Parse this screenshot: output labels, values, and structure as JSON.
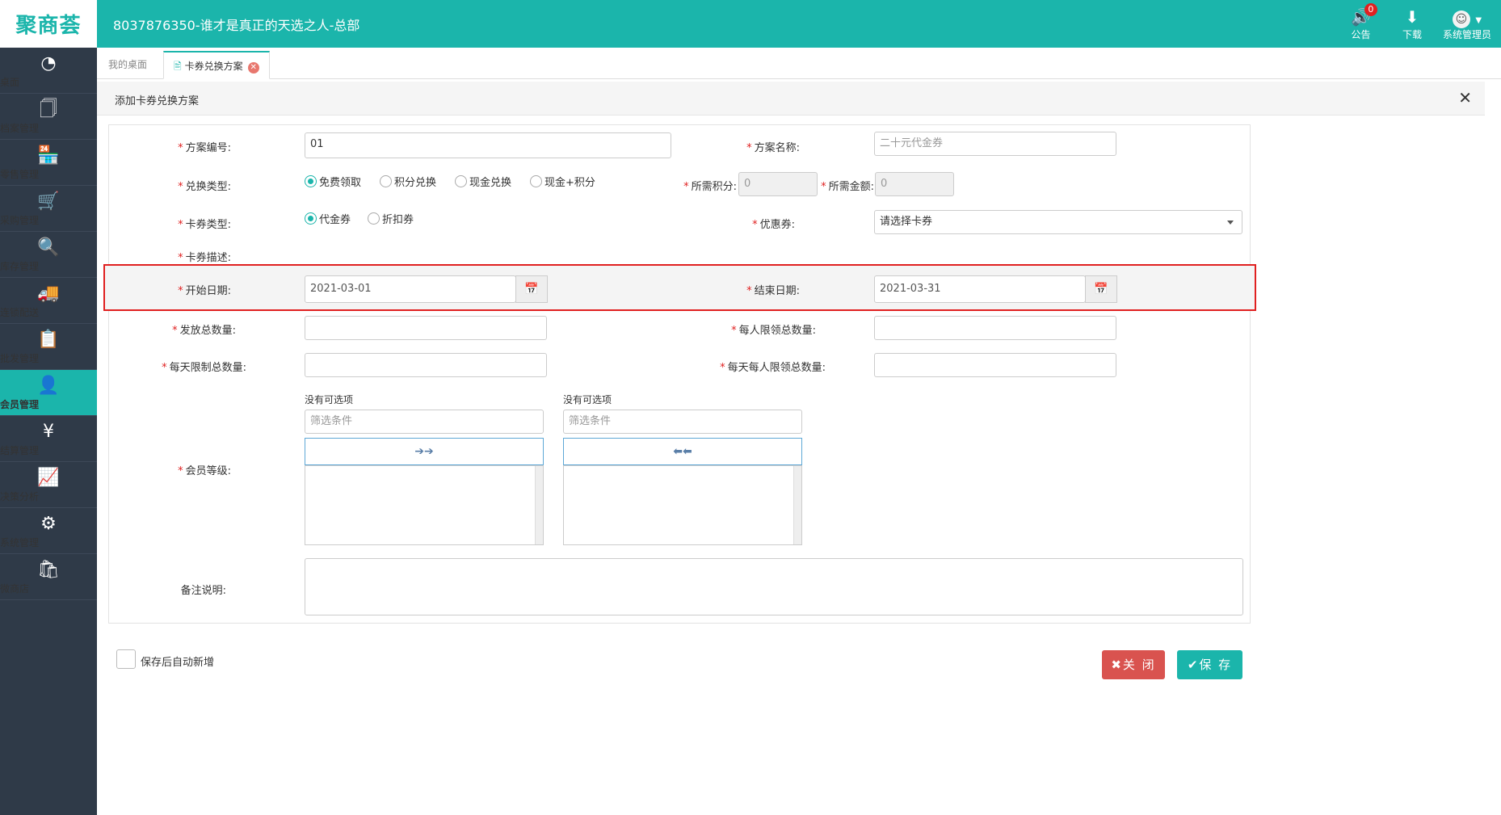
{
  "app": {
    "logo": "聚商荟",
    "title": "8037876350-谁才是真正的天选之人-总部"
  },
  "top_actions": {
    "notice": {
      "label": "公告",
      "badge": "0",
      "icon": "megaphone-icon"
    },
    "download": {
      "label": "下载",
      "icon": "download-icon"
    },
    "user": {
      "label": "系统管理员",
      "icon": "user-avatar-icon"
    }
  },
  "sidebar": {
    "items": [
      {
        "label": "桌面",
        "icon": "dashboard-icon"
      },
      {
        "label": "档案管理",
        "icon": "archive-icon"
      },
      {
        "label": "零售管理",
        "icon": "store-icon"
      },
      {
        "label": "采购管理",
        "icon": "cart-icon"
      },
      {
        "label": "库存管理",
        "icon": "inventory-icon"
      },
      {
        "label": "连锁配送",
        "icon": "truck-icon"
      },
      {
        "label": "批发管理",
        "icon": "wholesale-icon"
      },
      {
        "label": "会员管理",
        "icon": "member-icon",
        "active": true
      },
      {
        "label": "结算管理",
        "icon": "yen-icon"
      },
      {
        "label": "决策分析",
        "icon": "chart-icon"
      },
      {
        "label": "系统管理",
        "icon": "gear-icon"
      },
      {
        "label": "微商店",
        "icon": "bag-icon"
      }
    ]
  },
  "tabs": [
    {
      "label": "我的桌面"
    },
    {
      "label": "卡券兑换方案",
      "active": true
    }
  ],
  "panel": {
    "title": "添加卡券兑换方案"
  },
  "form": {
    "plan_no": {
      "label": "方案编号:",
      "value": "01"
    },
    "plan_name": {
      "label": "方案名称:",
      "placeholder": "二十元代金券"
    },
    "exchange_type": {
      "label": "兑换类型:",
      "options": [
        "免费领取",
        "积分兑换",
        "现金兑换",
        "现金+积分"
      ],
      "selected": "免费领取"
    },
    "points_needed": {
      "label": "所需积分:",
      "value": "0"
    },
    "amount_needed": {
      "label": "所需金额:",
      "value": "0"
    },
    "card_type": {
      "label": "卡券类型:",
      "options": [
        "代金券",
        "折扣券"
      ],
      "selected": "代金券"
    },
    "coupon": {
      "label": "优惠券:",
      "value": "请选择卡券"
    },
    "card_desc": {
      "label": "卡券描述:"
    },
    "start_date": {
      "label": "开始日期:",
      "value": "2021-03-01"
    },
    "end_date": {
      "label": "结束日期:",
      "value": "2021-03-31"
    },
    "total_issue": {
      "label": "发放总数量:",
      "value": ""
    },
    "per_person_limit": {
      "label": "每人限领总数量:",
      "value": ""
    },
    "daily_limit": {
      "label": "每天限制总数量:",
      "value": ""
    },
    "daily_per_person_limit": {
      "label": "每天每人限领总数量:",
      "value": ""
    },
    "member_level": {
      "label": "会员等级:",
      "left_caption": "没有可选项",
      "right_caption": "没有可选项",
      "filter_placeholder": "筛选条件",
      "move_right": "➔➔",
      "move_left": "⬅⬅"
    },
    "remark": {
      "label": "备注说明:",
      "value": ""
    }
  },
  "footer": {
    "auto_add_label": "保存后自动新增",
    "close_label": "✖关 闭",
    "save_label": "✔保 存"
  }
}
